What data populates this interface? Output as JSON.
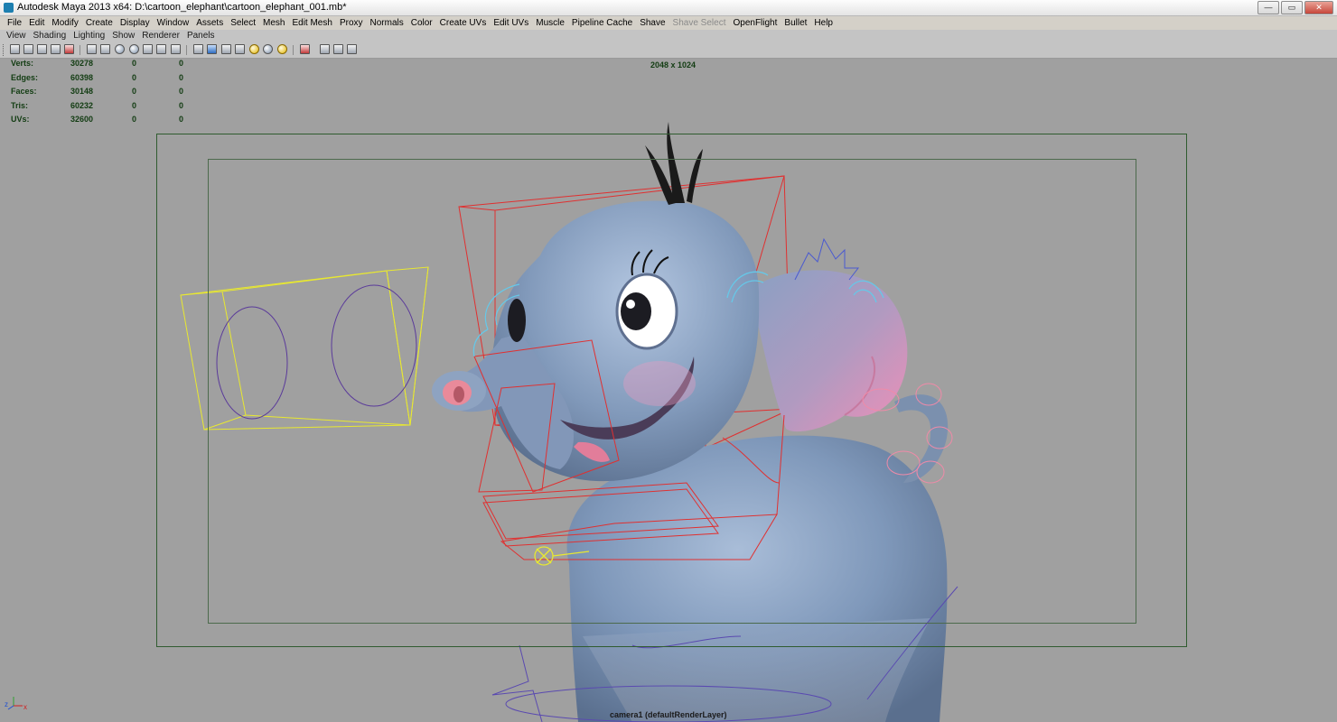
{
  "window": {
    "title": "Autodesk Maya 2013 x64: D:\\cartoon_elephant\\cartoon_elephant_001.mb*",
    "buttons": {
      "minimize": "—",
      "restore": "▭",
      "close": "✕"
    }
  },
  "menubar": {
    "items": [
      "File",
      "Edit",
      "Modify",
      "Create",
      "Display",
      "Window",
      "Assets",
      "Select",
      "Mesh",
      "Edit Mesh",
      "Proxy",
      "Normals",
      "Color",
      "Create UVs",
      "Edit UVs",
      "Muscle",
      "Pipeline Cache",
      "Shave",
      "Shave Select",
      "OpenFlight",
      "Bullet",
      "Help"
    ],
    "disabled": [
      "Shave Select"
    ]
  },
  "panel_menu": {
    "items": [
      "View",
      "Shading",
      "Lighting",
      "Show",
      "Renderer",
      "Panels"
    ]
  },
  "viewport": {
    "hud": [
      {
        "label": "Verts:",
        "values": [
          "30278",
          "0",
          "0"
        ]
      },
      {
        "label": "Edges:",
        "values": [
          "60398",
          "0",
          "0"
        ]
      },
      {
        "label": "Faces:",
        "values": [
          "30148",
          "0",
          "0"
        ]
      },
      {
        "label": "Tris:",
        "values": [
          "60232",
          "0",
          "0"
        ]
      },
      {
        "label": "UVs:",
        "values": [
          "32600",
          "0",
          "0"
        ]
      }
    ],
    "resolution": "2048 x 1024",
    "camera_label": "camera1 (defaultRenderLayer)",
    "axis": {
      "x": "x",
      "z": "z"
    }
  },
  "colors": {
    "viewport_bg": "#a0a0a0",
    "resolution_gate": "#305c30",
    "hud_text": "#123c12",
    "rig_red": "#e03030",
    "rig_yellow": "#e8e830",
    "elephant_body": "#7d95b5",
    "elephant_pink": "#e88aaa"
  }
}
